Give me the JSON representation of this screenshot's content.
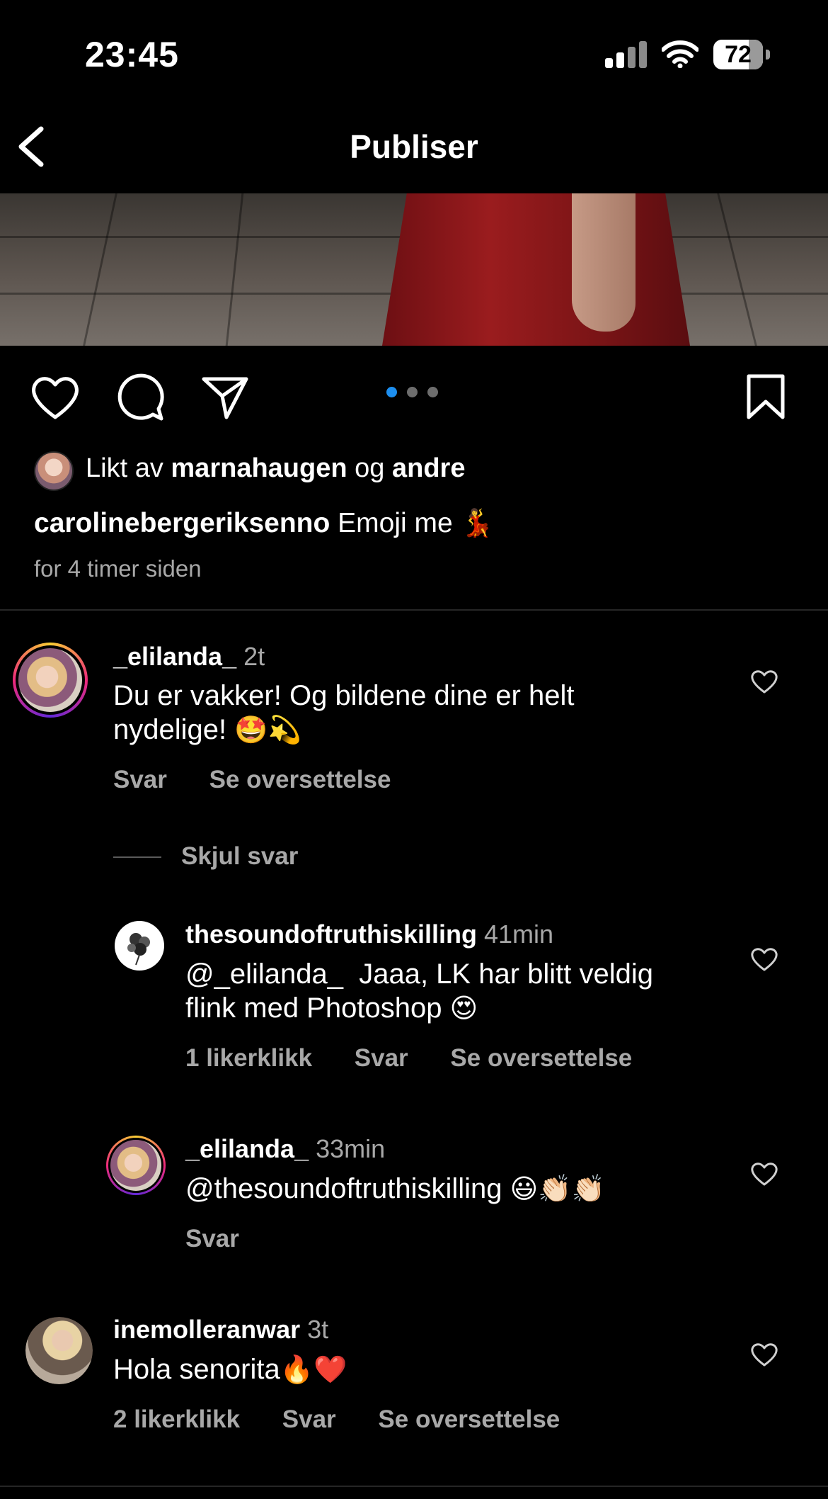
{
  "status_bar": {
    "time": "23:45",
    "battery": "72"
  },
  "header": {
    "title": "Publiser"
  },
  "carousel": {
    "count": 3,
    "active_index": 0
  },
  "likes": {
    "prefix": "Likt av",
    "user": "marnahaugen",
    "joiner": "og",
    "others": "andre"
  },
  "caption": {
    "username": "carolinebergeriksenno",
    "text": "Emoji me",
    "emoji": "💃"
  },
  "post_time": "for 4 timer siden",
  "comments": [
    {
      "username": "_elilanda_",
      "time": "2t",
      "text_line1": "Du er vakker! Og bildene dine er helt",
      "text_line2": "nydelige!",
      "emoji": "🤩💫",
      "reply_label": "Svar",
      "translate_label": "Se oversettelse"
    },
    {
      "username": "inemolleranwar",
      "time": "3t",
      "text": "Hola senorita",
      "emoji": "🔥❤️",
      "likes": "2 likerklikk",
      "reply_label": "Svar",
      "translate_label": "Se oversettelse"
    }
  ],
  "hide_replies": "Skjul svar",
  "replies": [
    {
      "username": "thesoundoftruthiskilling",
      "time": "41min",
      "text_line1": "@_elilanda_  Jaaa, LK har blitt veldig",
      "text_line2": "flink med Photoshop",
      "emoji": "😍",
      "likes": "1 likerklikk",
      "reply_label": "Svar",
      "translate_label": "Se oversettelse"
    },
    {
      "username": "_elilanda_",
      "time": "33min",
      "text": "@thesoundoftruthiskilling",
      "emoji": "😃👏🏻👏🏻",
      "reply_label": "Svar"
    }
  ],
  "colors": {
    "background": "#000000",
    "secondary_text": "#a8a8a8",
    "accent_dot": "#1d8ff0"
  },
  "icons": [
    "back-chevron-icon",
    "heart-icon",
    "comment-icon",
    "share-icon",
    "bookmark-icon"
  ]
}
